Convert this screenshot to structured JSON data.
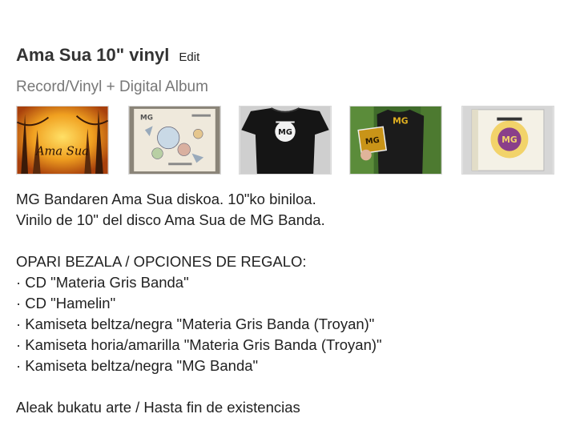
{
  "product": {
    "title": "Ama Sua 10\" vinyl",
    "edit_label": "Edit",
    "format": "Record/Vinyl + Digital Album"
  },
  "thumbnails": [
    {
      "name": "album-cover-art",
      "icon": "album-cover-image",
      "logo_text": "Ama Sua"
    },
    {
      "name": "vinyl-insert-illustration",
      "icon": "illustrated-insert-image",
      "logo_text": "MG"
    },
    {
      "name": "black-tshirt",
      "icon": "tshirt-image",
      "logo_text": "MG"
    },
    {
      "name": "person-holding-cd",
      "icon": "person-photo-image",
      "logo_text": "MG"
    },
    {
      "name": "cd-case",
      "icon": "cd-case-image",
      "logo_text": "MG"
    }
  ],
  "description": {
    "lines": [
      "MG Bandaren Ama Sua diskoa. 10\"ko biniloa.",
      "Vinilo de 10\" del disco Ama Sua de MG Banda.",
      "",
      "OPARI BEZALA / OPCIONES DE REGALO:",
      "· CD \"Materia Gris Banda\"",
      "· CD \"Hamelin\"",
      "· Kamiseta beltza/negra \"Materia Gris Banda (Troyan)\"",
      "· Kamiseta horia/amarilla \"Materia Gris Banda (Troyan)\"",
      "· Kamiseta beltza/negra \"MG Banda\"",
      "",
      "Aleak bukatu arte / Hasta fin de existencias"
    ]
  }
}
